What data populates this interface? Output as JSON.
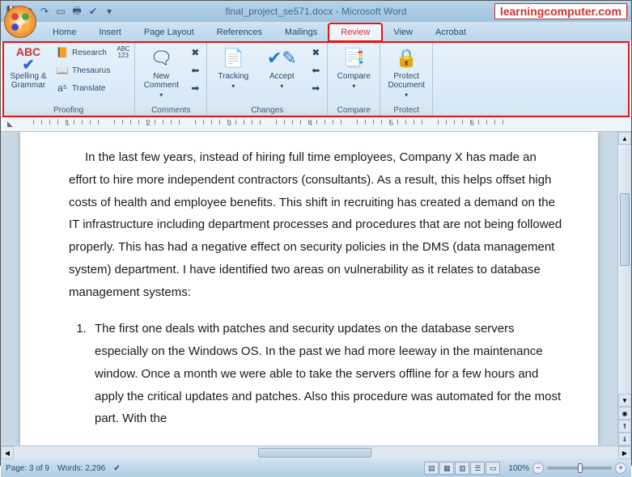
{
  "watermark": "learningcomputer.com",
  "title": "final_project_se571.docx - Microsoft Word",
  "tabs": [
    "Home",
    "Insert",
    "Page Layout",
    "References",
    "Mailings",
    "Review",
    "View",
    "Acrobat"
  ],
  "active_tab": "Review",
  "ribbon": {
    "proofing": {
      "label": "Proofing",
      "spelling": "Spelling &\nGrammar",
      "research": "Research",
      "thesaurus": "Thesaurus",
      "translate": "Translate",
      "wordcount_icon": "ABC\n123"
    },
    "comments": {
      "label": "Comments",
      "new_comment": "New\nComment"
    },
    "changes": {
      "label": "Changes",
      "tracking": "Tracking",
      "accept": "Accept"
    },
    "compare": {
      "label": "Compare",
      "compare": "Compare"
    },
    "protect": {
      "label": "Protect",
      "protect": "Protect\nDocument"
    }
  },
  "ruler_marks": [
    "1",
    "2",
    "3",
    "4",
    "5",
    "6"
  ],
  "document": {
    "para1": "In the last few years, instead of hiring full time employees, Company X has made an effort to hire more independent contractors (consultants). As a result, this helps offset high costs of health and employee benefits. This shift in recruiting has created a demand on the IT infrastructure including department processes and procedures that are not being followed properly. This has had a negative effect on security policies in the DMS (data management system) department. I have identified two areas on vulnerability as it relates to database management systems:",
    "list1": "The first one deals with patches and security updates on the database servers especially on the Windows OS. In the past we had more leeway in the maintenance window. Once a month we were able to take the servers offline for a few hours and apply the critical updates and patches. Also this procedure was automated for the most part. With the"
  },
  "status": {
    "page": "Page: 3 of 9",
    "words": "Words: 2,296",
    "zoom": "100%"
  }
}
